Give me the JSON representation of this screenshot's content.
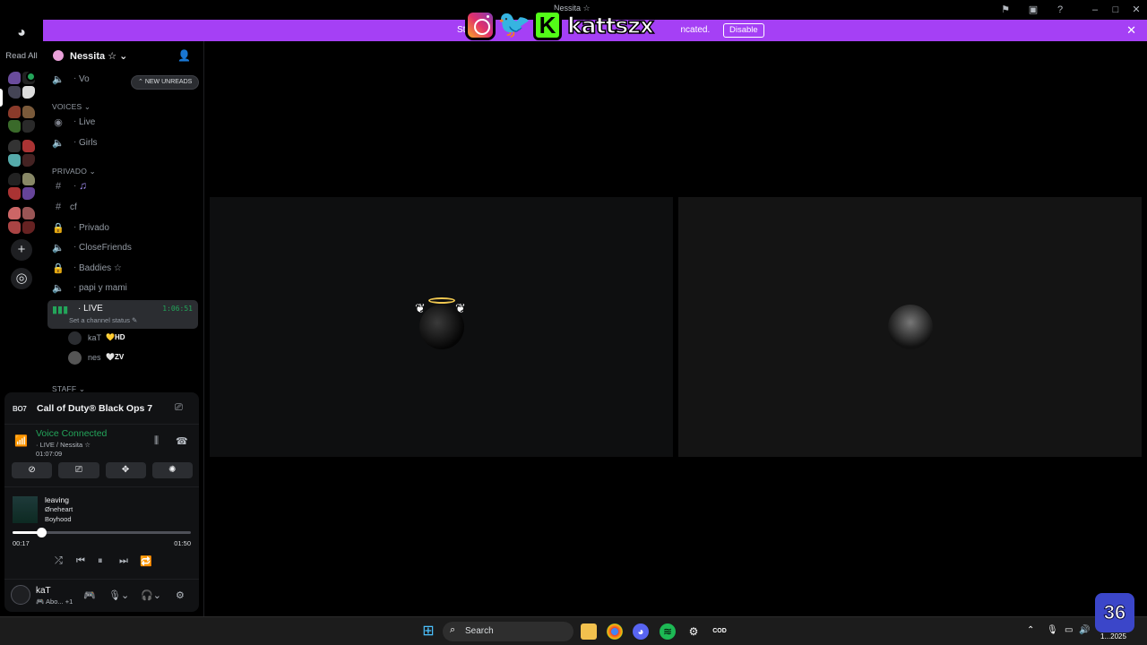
{
  "window": {
    "title": "Nessita ☆",
    "icons": [
      "flag-icon",
      "inbox-icon",
      "help-icon",
      "minimize-icon",
      "maximize-icon",
      "close-icon"
    ]
  },
  "banner": {
    "text_start": "St",
    "text_end": "ncated.",
    "disable_label": "Disable",
    "color": "#a540f5"
  },
  "overlay": {
    "handle": "kattszx",
    "k_letter": "K"
  },
  "rail": {
    "read_all": "Read All"
  },
  "server": {
    "name": "Nessita ☆",
    "new_unreads": "NEW UNREADS"
  },
  "channels": {
    "voice_top": "Vo",
    "cat_voices": "VOICES",
    "live_voice": "Live",
    "girls": "Girls",
    "cat_privado": "PRIVADO",
    "music": "♫",
    "cf": "cf",
    "privado": "Privado",
    "closefriends": "CloseFriends",
    "baddies": "Baddies ☆",
    "papi": "papi y mami",
    "live": "LIVE",
    "live_timer": "1:06:51",
    "live_status": "Set a channel status",
    "user1": "kaT",
    "user1_tag": "HD",
    "user2": "nes",
    "user2_tag": "ZV",
    "cat_staff": "STAFF"
  },
  "panel": {
    "game_logo": "BO7",
    "game_name": "Call of Duty® Black Ops 7",
    "voice_title": "Voice Connected",
    "voice_sub": "LIVE / Nessita ☆",
    "voice_time": "01:07:09",
    "track_title": "leaving",
    "track_artist": "Øneheart",
    "track_album": "Boyhood",
    "time_current": "00:17",
    "time_total": "01:50",
    "progress": 0.16,
    "username": "kaT",
    "activity": "Abo... +1"
  },
  "taskbar": {
    "search": "Search",
    "clock_line1": "M",
    "clock_line2": "1...2025",
    "corner_logo": "36"
  }
}
